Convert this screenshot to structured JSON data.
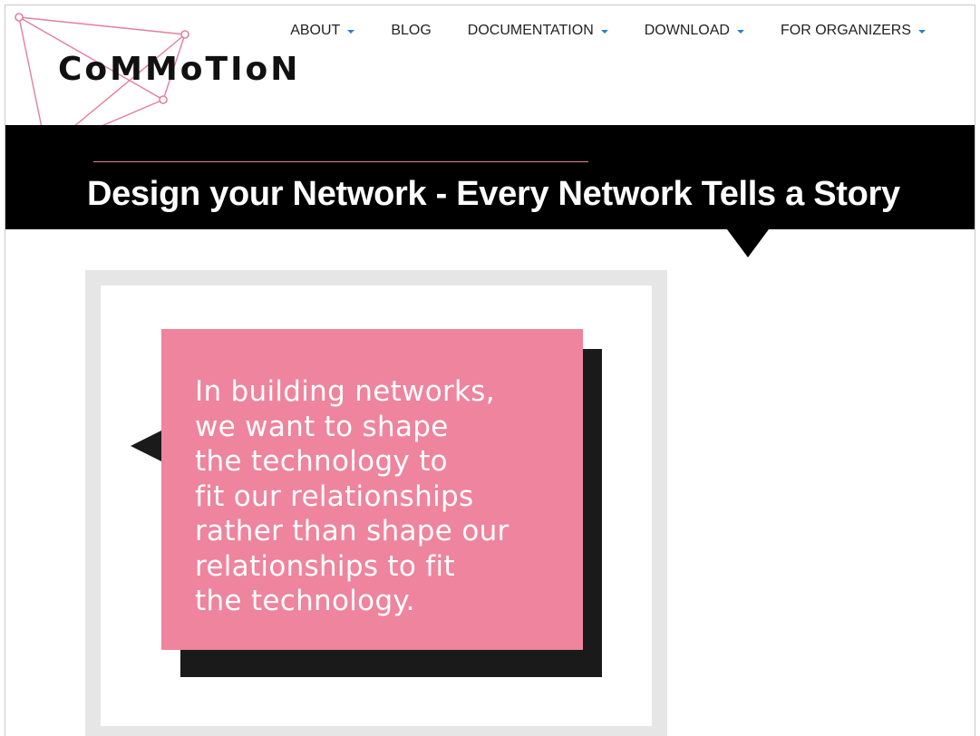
{
  "logo": {
    "text": "CoMMoTIoN",
    "accent_color": "#e57f9b"
  },
  "nav": {
    "items": [
      {
        "label": "ABOUT",
        "has_dropdown": true
      },
      {
        "label": "BLOG",
        "has_dropdown": false
      },
      {
        "label": "DOCUMENTATION",
        "has_dropdown": true
      },
      {
        "label": "DOWNLOAD",
        "has_dropdown": true
      },
      {
        "label": "FOR ORGANIZERS",
        "has_dropdown": true
      }
    ],
    "caret_color": "#2a7fd1"
  },
  "banner": {
    "title": "Design your Network - Every Network Tells a Story",
    "background": "#000000"
  },
  "quote_card": {
    "text": "In building networks,\nwe want to shape\nthe technology to\nfit our relationships\nrather than shape our\nrelationships to fit\nthe technology.",
    "box_color": "#ee849d",
    "shadow_color": "#1a1a1a"
  }
}
